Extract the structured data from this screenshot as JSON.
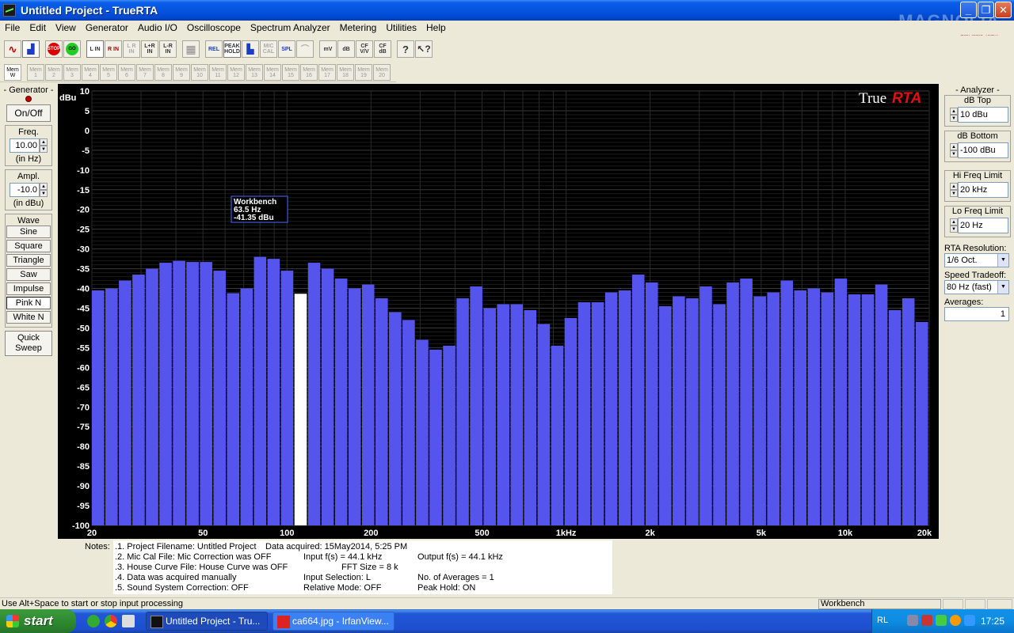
{
  "window": {
    "title": "Untitled Project - TrueRTA",
    "watermark": "MAGNOLIA",
    "watermark_sub": "CarAudio Team"
  },
  "menu": [
    "File",
    "Edit",
    "View",
    "Generator",
    "Audio I/O",
    "Oscilloscope",
    "Spectrum Analyzer",
    "Metering",
    "Utilities",
    "Help"
  ],
  "toolbar1": {
    "stop": "STOP",
    "go": "GO",
    "l_in": "L IN",
    "r_in": "R IN",
    "lr_in": "L R IN",
    "lpr_in": "L+R IN",
    "lmr_in": "L-R IN",
    "rel": "REL",
    "peak_hold": "PEAK HOLD",
    "mic_cal": "MIC CAL",
    "spl": "SPL",
    "mv": "mV",
    "db": "dB",
    "cf_vv": "CF V/V",
    "cf_db": "CF dB"
  },
  "toolbar2": {
    "mem_w": "Mem W",
    "mems": [
      "Mem 1",
      "Mem 2",
      "Mem 3",
      "Mem 4",
      "Mem 5",
      "Mem 6",
      "Mem 7",
      "Mem 8",
      "Mem 9",
      "Mem 10",
      "Mem 11",
      "Mem 12",
      "Mem 13",
      "Mem 14",
      "Mem 15",
      "Mem 16",
      "Mem 17",
      "Mem 18",
      "Mem 19",
      "Mem 20"
    ]
  },
  "generator": {
    "title": "Generator",
    "onoff": "On/Off",
    "freq_label": "Freq.",
    "freq_value": "10.00",
    "freq_unit": "(in Hz)",
    "ampl_label": "Ampl.",
    "ampl_value": "-10.0",
    "ampl_unit": "(in dBu)",
    "wave_label": "Wave",
    "waves": [
      "Sine",
      "Square",
      "Triangle",
      "Saw",
      "Impulse",
      "Pink N",
      "White N"
    ],
    "quick_sweep_1": "Quick",
    "quick_sweep_2": "Sweep"
  },
  "analyzer": {
    "title": "Analyzer",
    "db_top_label": "dB Top",
    "db_top": "10 dBu",
    "db_bottom_label": "dB Bottom",
    "db_bottom": "-100 dBu",
    "hi_freq_label": "Hi Freq Limit",
    "hi_freq": "20 kHz",
    "lo_freq_label": "Lo Freq Limit",
    "lo_freq": "20 Hz",
    "rta_res_label": "RTA Resolution:",
    "rta_res": "1/6 Oct.",
    "speed_label": "Speed Tradeoff:",
    "speed": "80 Hz (fast)",
    "avg_label": "Averages:",
    "avg": "1"
  },
  "chart_data": {
    "type": "bar",
    "title": "",
    "logo_true": "True",
    "logo_rta": "RTA",
    "ylabel": "dBu",
    "ylim": [
      -100,
      10
    ],
    "y_ticks": [
      "10",
      "5",
      "0",
      "-5",
      "-10",
      "-15",
      "-20",
      "-25",
      "-30",
      "-35",
      "-40",
      "-45",
      "-50",
      "-55",
      "-60",
      "-65",
      "-70",
      "-75",
      "-80",
      "-85",
      "-90",
      "-95",
      "-100"
    ],
    "x_scale": "log",
    "xlim": [
      20,
      20000
    ],
    "x_ticks": [
      {
        "value": 20,
        "label": "20"
      },
      {
        "value": 50,
        "label": "50"
      },
      {
        "value": 100,
        "label": "100"
      },
      {
        "value": 200,
        "label": "200"
      },
      {
        "value": 500,
        "label": "500"
      },
      {
        "value": 1000,
        "label": "1kHz"
      },
      {
        "value": 2000,
        "label": "2k"
      },
      {
        "value": 5000,
        "label": "5k"
      },
      {
        "value": 10000,
        "label": "10k"
      },
      {
        "value": 20000,
        "label": "20k"
      }
    ],
    "bar_color": "#5555ee",
    "highlight_color": "#ffffff",
    "highlight_index": 15,
    "values": [
      -40.5,
      -40,
      -38,
      -36.5,
      -35,
      -33.5,
      -33,
      -33.3,
      -33.3,
      -35.5,
      -41.2,
      -40,
      -32,
      -32.5,
      -35.5,
      -41.35,
      -33.5,
      -35,
      -37.5,
      -40,
      -39,
      -42.5,
      -46,
      -48,
      -53,
      -55.5,
      -54.5,
      -42.5,
      -39.5,
      -45,
      -44,
      -44,
      -45.5,
      -49,
      -54.5,
      -47.5,
      -43.5,
      -43.5,
      -41,
      -40.5,
      -36.5,
      -38.5,
      -44.5,
      -42,
      -42.5,
      -39.5,
      -44,
      -38.5,
      -37.5,
      -42,
      -41,
      -38,
      -40.5,
      -40,
      -41,
      -37.5,
      -41.5,
      -41.5,
      -39,
      -45.5,
      -42.5,
      -48.5
    ],
    "tooltip": {
      "line1": "Workbench",
      "line2": "63.5 Hz",
      "line3": "-41.35 dBu"
    }
  },
  "notes": {
    "label": "Notes:",
    "lines": [
      ".1. Project Filename: Untitled Project",
      ".2. Mic Cal File: Mic Correction was OFF",
      ".3. House Curve File: House Curve was OFF",
      ".4. Data was acquired manually",
      ".5. Sound System Correction: OFF"
    ],
    "data_acquired": "Data acquired: 15May2014, 5:25 PM",
    "input_fs": "Input f(s) = 44.1 kHz",
    "output_fs": "Output f(s) = 44.1 kHz",
    "fft_size": "FFT Size = 8 k",
    "input_selection": "Input Selection: L",
    "num_averages": "No. of Averages = 1",
    "relative_mode": "Relative Mode:  OFF",
    "peak_hold": "Peak Hold: ON"
  },
  "statusbar": {
    "text": "Use Alt+Space to start or stop input processing",
    "panel": "Workbench"
  },
  "taskbar": {
    "start": "start",
    "task1": "Untitled Project - Tru...",
    "task2": "ca664.jpg - IrfanView...",
    "lang": "RL",
    "clock": "17:25"
  }
}
